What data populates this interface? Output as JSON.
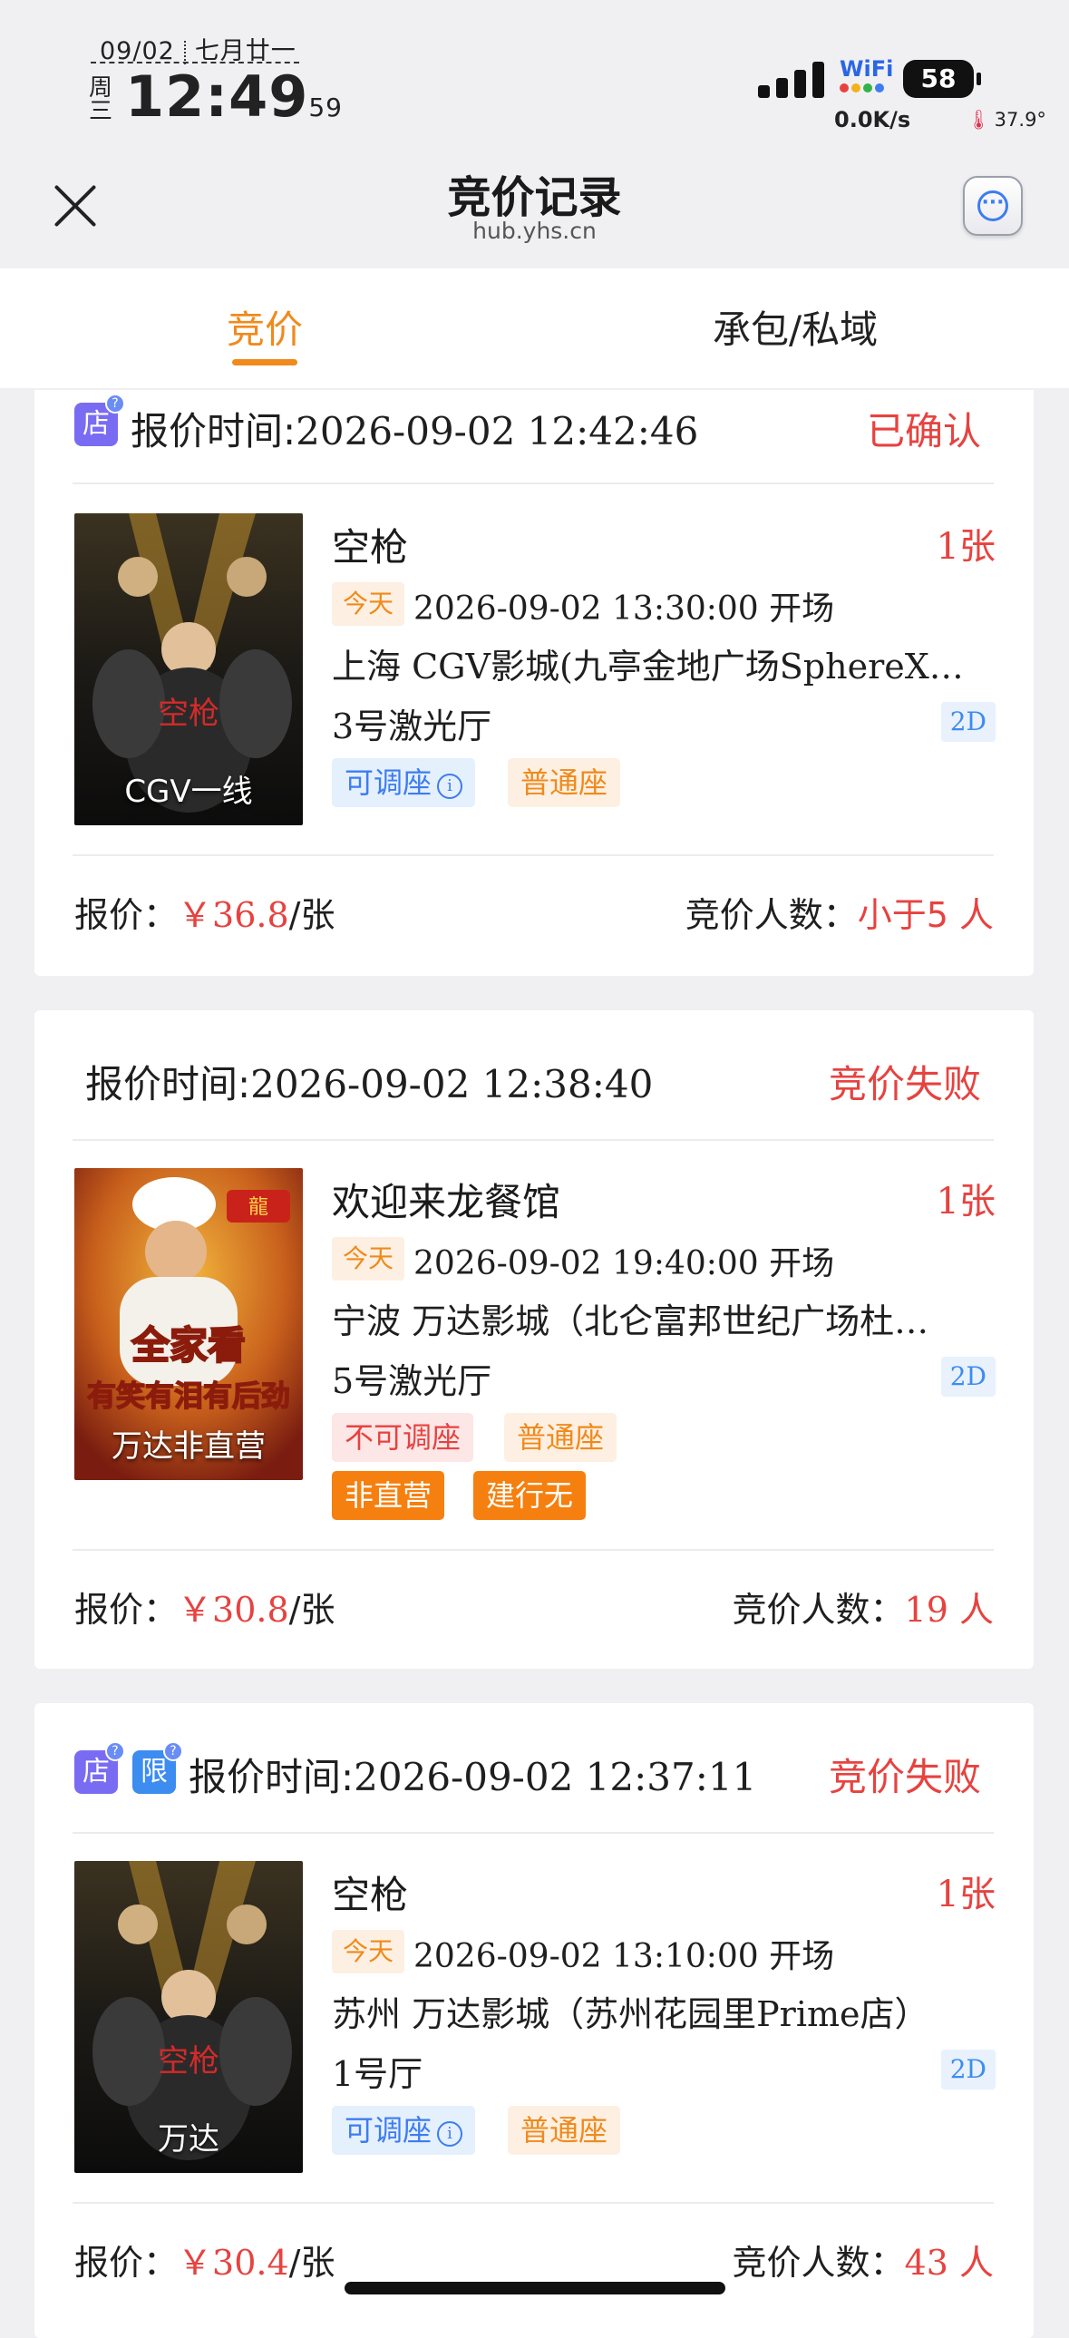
{
  "status_bar": {
    "date": "09/02",
    "lunar_date": "七月廿一",
    "weekday_top": "周",
    "weekday_bottom": "三",
    "time": "12:49",
    "seconds": "59",
    "wifi_label": "WiFi",
    "battery": "58",
    "net_speed": "0.0K/s",
    "temperature": "37.9°"
  },
  "nav": {
    "title": "竞价记录",
    "subtitle": "hub.yhs.cn"
  },
  "tabs": [
    {
      "label": "竞价",
      "active": true
    },
    {
      "label": "承包/私域",
      "active": false
    }
  ],
  "records": [
    {
      "badges": [
        "店"
      ],
      "quote_time_label": "报价时间:",
      "quote_time": "2026-09-02 12:42:46",
      "status": "已确认",
      "poster_caption": "CGV一线",
      "movie": "空枪",
      "qty_num": "1",
      "qty_unit": "张",
      "today": "今天",
      "show_time": "2026-09-02 13:30:00",
      "show_suffix": "开场",
      "cinema": "上海 CGV影城(九亭金地广场SphereX…",
      "hall": "3号激光厅",
      "format": "2D",
      "tags": [
        "可调座",
        "普通座"
      ],
      "price_label": "报价：",
      "price": "￥36.8",
      "price_unit": "/张",
      "bidders_label": "竞价人数：",
      "bidders_num": "小于5",
      "bidders_unit": "人"
    },
    {
      "badges": [],
      "quote_time_label": "报价时间:",
      "quote_time": "2026-09-02 12:38:40",
      "status": "竞价失败",
      "poster_caption": "万达非直营",
      "poster_text": "全家看",
      "poster_text2": "有笑有泪有后劲",
      "movie": "欢迎来龙餐馆",
      "qty_num": "1",
      "qty_unit": "张",
      "today": "今天",
      "show_time": "2026-09-02 19:40:00",
      "show_suffix": "开场",
      "cinema": "宁波 万达影城（北仑富邦世纪广场杜…",
      "hall": "5号激光厅",
      "format": "2D",
      "tags": [
        "不可调座",
        "普通座"
      ],
      "tags2": [
        "非直营",
        "建行无"
      ],
      "price_label": "报价：",
      "price": "￥30.8",
      "price_unit": "/张",
      "bidders_label": "竞价人数：",
      "bidders_num": "19",
      "bidders_unit": "人"
    },
    {
      "badges": [
        "店",
        "限"
      ],
      "quote_time_label": "报价时间:",
      "quote_time": "2026-09-02 12:37:11",
      "status": "竞价失败",
      "poster_caption": "万达",
      "movie": "空枪",
      "qty_num": "1",
      "qty_unit": "张",
      "today": "今天",
      "show_time": "2026-09-02 13:10:00",
      "show_suffix": "开场",
      "cinema": "苏州 万达影城（苏州花园里Prime店）",
      "hall": "1号厅",
      "format": "2D",
      "tags": [
        "可调座",
        "普通座"
      ],
      "price_label": "报价：",
      "price": "￥30.4",
      "price_unit": "/张",
      "bidders_label": "竞价人数：",
      "bidders_num": "43",
      "bidders_unit": "人"
    }
  ],
  "colors": {
    "accent": "#f08a1c",
    "danger": "#e64340",
    "link": "#3d7df0",
    "background": "#f0f0f3"
  }
}
